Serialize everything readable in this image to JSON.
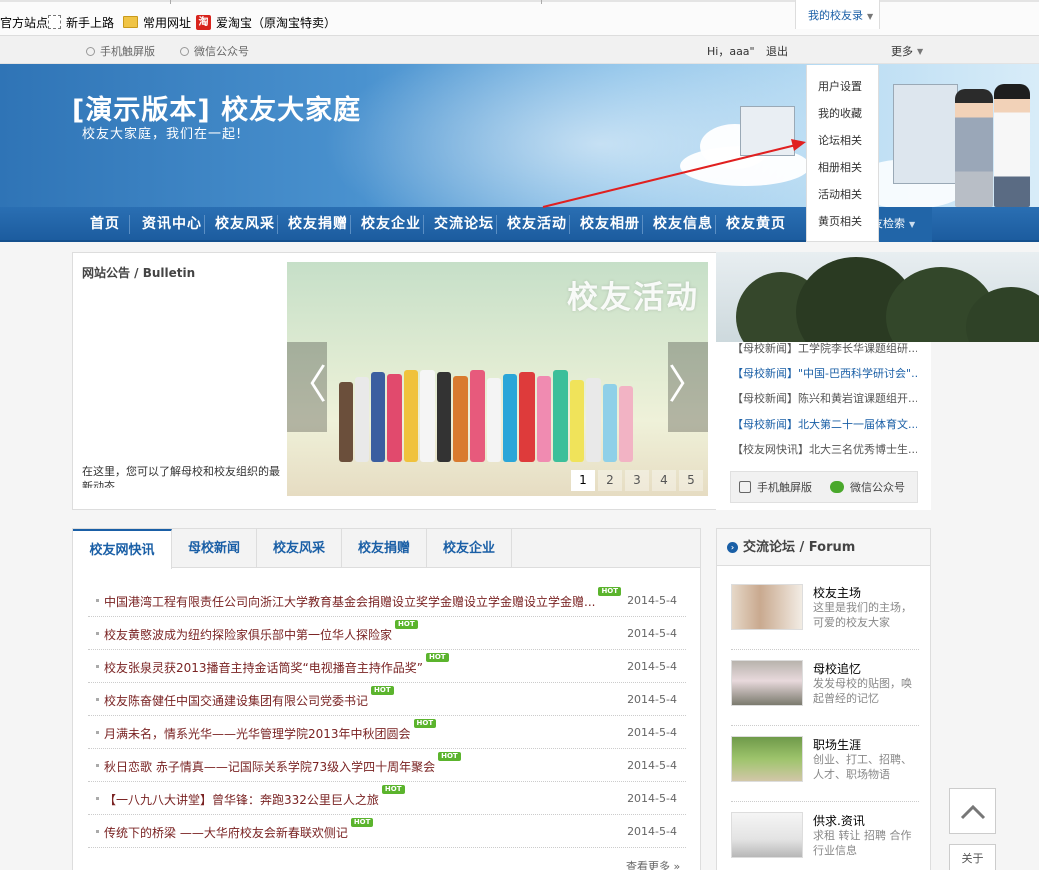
{
  "bookmarks": [
    {
      "label": "官方站点",
      "icon": "none"
    },
    {
      "label": "新手上路",
      "icon": "blank-page-icon"
    },
    {
      "label": "常用网址",
      "icon": "folder-icon"
    },
    {
      "label": "爱淘宝（原淘宝特卖）",
      "icon": "taobao-icon",
      "icon_text": "淘"
    }
  ],
  "userbar": {
    "mobile": "手机触屏版",
    "wechat": "微信公众号",
    "greeting": "Hi，aaa\"",
    "logout": "退出",
    "my_friends": "我的校友录",
    "more": "更多"
  },
  "dropdown": [
    "用户设置",
    "我的收藏",
    "论坛相关",
    "相册相关",
    "活动相关",
    "黄页相关"
  ],
  "banner": {
    "title": "[演示版本] 校友大家庭",
    "subtitle": "校友大家庭，我们在一起!"
  },
  "nav": [
    "首页",
    "资讯中心",
    "校友风采",
    "校友捐赠",
    "校友企业",
    "交流论坛",
    "校友活动",
    "校友相册",
    "校友信息",
    "校友黄页"
  ],
  "nav_search": "友检索",
  "bulletin": {
    "title": "网站公告 / Bulletin",
    "text": "在这里，您可以了解母校和校友组织的最新动态"
  },
  "slider": {
    "caption": "校友活动",
    "pages": [
      "1",
      "2",
      "3",
      "4",
      "5"
    ],
    "active_page": "1",
    "prev": "〈",
    "next": "〉"
  },
  "side_news": [
    {
      "text": "【母校新闻】工学院李长华课题组研...",
      "blue": false
    },
    {
      "text": "【母校新闻】\"中国-巴西科学研讨会\"...",
      "blue": true
    },
    {
      "text": "【母校新闻】陈兴和黄岩谊课题组开...",
      "blue": false
    },
    {
      "text": "【母校新闻】北大第二十一届体育文...",
      "blue": true
    },
    {
      "text": "【校友网快讯】北大三名优秀博士生...",
      "blue": false
    }
  ],
  "side_share": {
    "mobile": "手机触屏版",
    "wechat": "微信公众号"
  },
  "tabs": [
    "校友网快讯",
    "母校新闻",
    "校友风采",
    "校友捐赠",
    "校友企业"
  ],
  "news": [
    {
      "title": "中国港湾工程有限责任公司向浙江大学教育基金会捐赠设立奖学金赠设立学金赠设立学金赠...",
      "date": "2014-5-4"
    },
    {
      "title": "校友黄愍波成为纽约探险家俱乐部中第一位华人探险家",
      "date": "2014-5-4"
    },
    {
      "title": "校友张泉灵获2013播音主持金话筒奖“电视播音主持作品奖”",
      "date": "2014-5-4"
    },
    {
      "title": "校友陈奋健任中国交通建设集团有限公司党委书记",
      "date": "2014-5-4"
    },
    {
      "title": "月满未名，情系光华——光华管理学院2013年中秋团圆会",
      "date": "2014-5-4"
    },
    {
      "title": "秋日恋歌 赤子情真——记国际关系学院73级入学四十周年聚会",
      "date": "2014-5-4"
    },
    {
      "title": "【一八九八大讲堂】曾华锋：奔跑332公里巨人之旅",
      "date": "2014-5-4"
    },
    {
      "title": "传统下的桥梁 ——大华府校友会新春联欢侧记",
      "date": "2014-5-4"
    }
  ],
  "hot_label": "HOT",
  "more": "查看更多 »",
  "forum": {
    "title": "交流论坛 / Forum",
    "items": [
      {
        "title": "校友主场",
        "desc": "这里是我们的主场，可爱的校友大家"
      },
      {
        "title": "母校追忆",
        "desc": "发发母校的贴图，唤起曾经的记忆"
      },
      {
        "title": "职场生涯",
        "desc": "创业、打工、招聘、人才、职场物语"
      },
      {
        "title": "供求.资讯",
        "desc": "求租 转让 招聘 合作 行业信息"
      }
    ]
  },
  "about": "关于",
  "colors": {
    "brand_blue": "#1a5fa6",
    "nav_blue": "#2a6fb3",
    "hot_green": "#5bb42d",
    "news_red": "#7a2323",
    "annotation_arrow": "#e02020"
  }
}
